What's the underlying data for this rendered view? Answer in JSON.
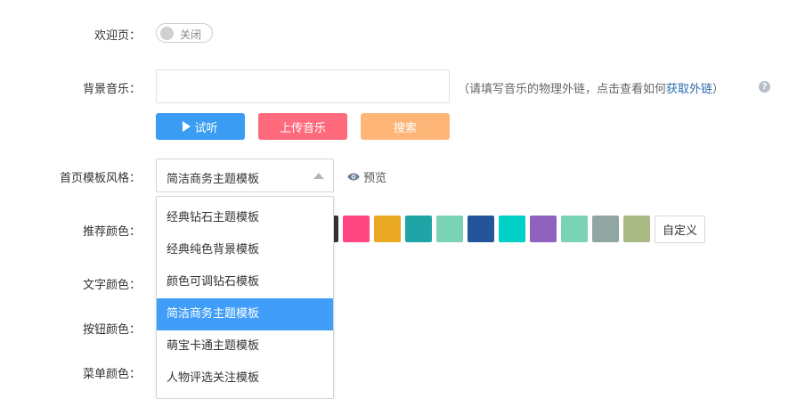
{
  "form": {
    "welcome": {
      "label": "欢迎页：",
      "toggle_text": "关闭"
    },
    "music": {
      "label": "背景音乐：",
      "input_value": "",
      "hint_open": "（",
      "hint_text": "请填写音乐的物理外链，点击查看如何",
      "hint_link": "获取外链",
      "hint_close": "）",
      "help_symbol": "?",
      "buttons": {
        "listen": "试听",
        "upload": "上传音乐",
        "search": "搜索"
      }
    },
    "template": {
      "label": "首页模板风格：",
      "selected": "简洁商务主题模板",
      "preview": "预览",
      "options": [
        "经典钻石主题模板",
        "经典纯色背景模板",
        "颜色可调钻石模板",
        "简洁商务主题模板",
        "萌宝卡通主题模板",
        "人物评选关注模板"
      ],
      "selected_index": 3
    },
    "recommend": {
      "label": "推荐颜色：",
      "swatches": [
        "#333333",
        "#fd4682",
        "#eaa922",
        "#1fa5a6",
        "#7ad3b4",
        "#24559a",
        "#00d0c6",
        "#9061bf",
        "#7ad3b4",
        "#91a6a2",
        "#a9ba84"
      ],
      "custom_label": "自定义"
    },
    "text_color": {
      "label": "文字颜色："
    },
    "button_color": {
      "label": "按钮颜色："
    },
    "menu_color": {
      "label": "菜单颜色："
    }
  },
  "colors": {
    "accent_blue": "#3a9cf2",
    "accent_pink": "#ff6b7c",
    "accent_orange": "#fdb678",
    "selected_option": "#409ef8"
  }
}
